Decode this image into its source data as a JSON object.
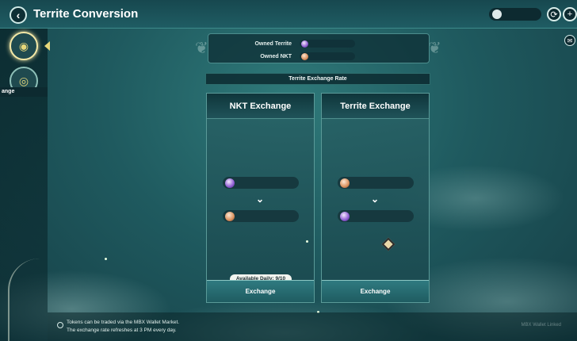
{
  "header": {
    "title": "Territe Conversion",
    "back_icon": "‹",
    "currency_icon": "link-coin-icon",
    "refresh_icon": "⟳",
    "add_icon": "+"
  },
  "sidebar": {
    "items": [
      {
        "icon": "territe-coin-icon",
        "active": true
      },
      {
        "icon": "exchange-coin-icon",
        "active": false,
        "label": "ange"
      }
    ]
  },
  "owned": {
    "territe_label": "Owned Territe",
    "nkt_label": "Owned NKT"
  },
  "rate_title": "Territe Exchange Rate",
  "panels": {
    "nkt": {
      "title": "NKT Exchange",
      "badge": "Available Daily: 9/10",
      "button": "Exchange"
    },
    "territe": {
      "title": "Territe Exchange",
      "button": "Exchange"
    }
  },
  "footer": {
    "line1": "Tokens can be traded via the MBX Wallet Market.",
    "line2": "The exchange rate refreshes at 3 PM every day.",
    "brand": "MBX Wallet Linked"
  },
  "colors": {
    "background": "#1f5a5f",
    "panel": "#286266",
    "accent": "#e6d77a"
  }
}
